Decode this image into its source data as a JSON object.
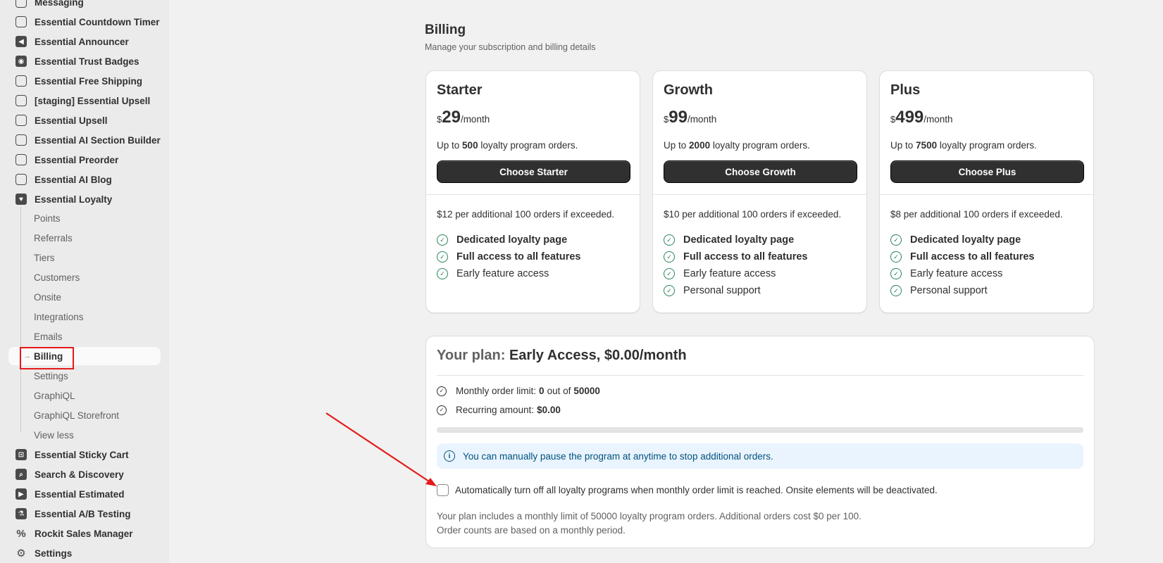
{
  "sidebar": {
    "items_top": [
      {
        "label": "Messaging",
        "icon": "messaging-icon"
      },
      {
        "label": "Essential Countdown Timer",
        "icon": "timer-icon"
      },
      {
        "label": "Essential Announcer",
        "icon": "megaphone-icon"
      },
      {
        "label": "Essential Trust Badges",
        "icon": "badge-icon"
      },
      {
        "label": "Essential Free Shipping",
        "icon": "shipping-icon"
      },
      {
        "label": "[staging] Essential Upsell",
        "icon": "upsell-icon"
      },
      {
        "label": "Essential Upsell",
        "icon": "upsell-icon"
      },
      {
        "label": "Essential AI Section Builder",
        "icon": "section-builder-icon"
      },
      {
        "label": "Essential Preorder",
        "icon": "preorder-icon"
      },
      {
        "label": "Essential AI Blog",
        "icon": "blog-icon"
      },
      {
        "label": "Essential Loyalty",
        "icon": "loyalty-heart-icon"
      }
    ],
    "sub_items": [
      {
        "label": "Points"
      },
      {
        "label": "Referrals"
      },
      {
        "label": "Tiers"
      },
      {
        "label": "Customers"
      },
      {
        "label": "Onsite"
      },
      {
        "label": "Integrations"
      },
      {
        "label": "Emails"
      },
      {
        "label": "Billing",
        "active": true
      },
      {
        "label": "Settings"
      },
      {
        "label": "GraphiQL"
      },
      {
        "label": "GraphiQL Storefront"
      },
      {
        "label": "View less"
      }
    ],
    "items_bottom": [
      {
        "label": "Essential Sticky Cart",
        "icon": "cart-icon"
      },
      {
        "label": "Search & Discovery",
        "icon": "search-icon"
      },
      {
        "label": "Essential Estimated",
        "icon": "truck-icon"
      },
      {
        "label": "Essential A/B Testing",
        "icon": "flask-icon"
      },
      {
        "label": "Rockit Sales Manager",
        "icon": "percent-icon"
      },
      {
        "label": "Settings",
        "icon": "gear-icon"
      }
    ]
  },
  "page": {
    "title": "Billing",
    "subtitle": "Manage your subscription and billing details"
  },
  "plans": [
    {
      "name": "Starter",
      "currency": "$",
      "price": "29",
      "period": "/month",
      "limit_prefix": "Up to",
      "limit_value": "500",
      "limit_suffix": "loyalty program orders.",
      "button": "Choose Starter",
      "extra": "$12 per additional 100 orders if exceeded.",
      "features": [
        {
          "label": "Dedicated loyalty page",
          "bold": true
        },
        {
          "label": "Full access to all features",
          "bold": true
        },
        {
          "label": "Early feature access",
          "bold": false
        }
      ]
    },
    {
      "name": "Growth",
      "currency": "$",
      "price": "99",
      "period": "/month",
      "limit_prefix": "Up to",
      "limit_value": "2000",
      "limit_suffix": "loyalty program orders.",
      "button": "Choose Growth",
      "extra": "$10 per additional 100 orders if exceeded.",
      "features": [
        {
          "label": "Dedicated loyalty page",
          "bold": true
        },
        {
          "label": "Full access to all features",
          "bold": true
        },
        {
          "label": "Early feature access",
          "bold": false
        },
        {
          "label": "Personal support",
          "bold": false
        }
      ]
    },
    {
      "name": "Plus",
      "currency": "$",
      "price": "499",
      "period": "/month",
      "limit_prefix": "Up to",
      "limit_value": "7500",
      "limit_suffix": "loyalty program orders.",
      "button": "Choose Plus",
      "extra": "$8 per additional 100 orders if exceeded.",
      "features": [
        {
          "label": "Dedicated loyalty page",
          "bold": true
        },
        {
          "label": "Full access to all features",
          "bold": true
        },
        {
          "label": "Early feature access",
          "bold": false
        },
        {
          "label": "Personal support",
          "bold": false
        }
      ]
    }
  ],
  "your_plan": {
    "label": "Your plan:",
    "value": "Early Access, $0.00/month",
    "order_limit_label": "Monthly order limit:",
    "order_used": "0",
    "order_mid": "out of",
    "order_total": "50000",
    "recurring_label": "Recurring amount:",
    "recurring_value": "$0.00",
    "progress_fraction": 0,
    "info_text": "You can manually pause the program at anytime to stop additional orders.",
    "auto_off_label": "Automatically turn off all loyalty programs when monthly order limit is reached. Onsite elements will be deactivated.",
    "auto_off_checked": false,
    "note_line1": "Your plan includes a monthly limit of 50000 loyalty program orders. Additional orders cost $0 per 100.",
    "note_line2": "Order counts are based on a monthly period."
  },
  "colors": {
    "accent_green": "#29845a",
    "button_dark": "#303030",
    "info_bg": "#eaf4ff",
    "annotation_red": "#e41a1a"
  }
}
